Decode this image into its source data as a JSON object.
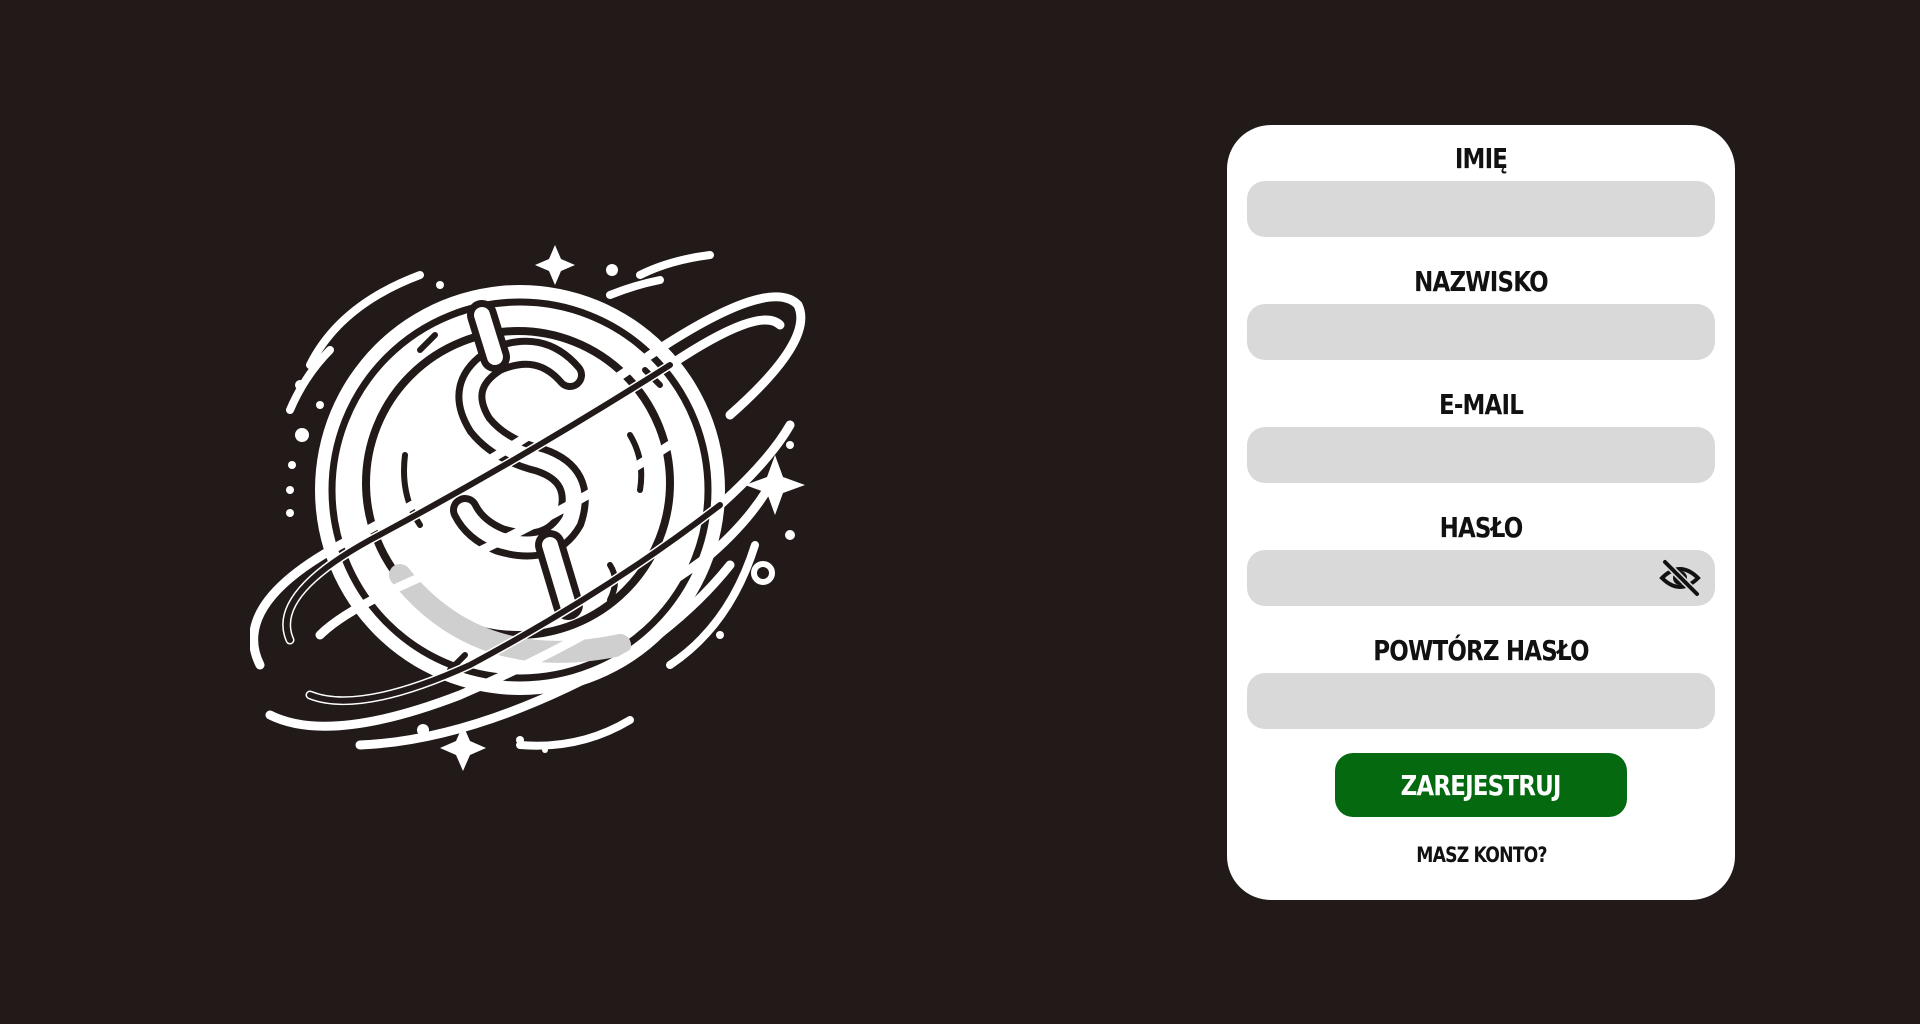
{
  "form": {
    "first_name": {
      "label": "IMIĘ",
      "value": "",
      "placeholder": ""
    },
    "last_name": {
      "label": "NAZWISKO",
      "value": "",
      "placeholder": ""
    },
    "email": {
      "label": "E-MAIL",
      "value": "",
      "placeholder": ""
    },
    "password": {
      "label": "HASŁO",
      "value": "",
      "placeholder": ""
    },
    "repeat_password": {
      "label": "POWTÓRZ HASŁO",
      "value": "",
      "placeholder": ""
    },
    "submit_label": "ZAREJESTRUJ",
    "login_link_label": "MASZ KONTO?"
  },
  "icons": {
    "logo": "planet-coin-dollar-logo",
    "password_toggle": "eye-slash-icon"
  },
  "colors": {
    "background": "#211a19",
    "card": "#ffffff",
    "input": "#d9d9d9",
    "primary_button": "#05690f"
  }
}
